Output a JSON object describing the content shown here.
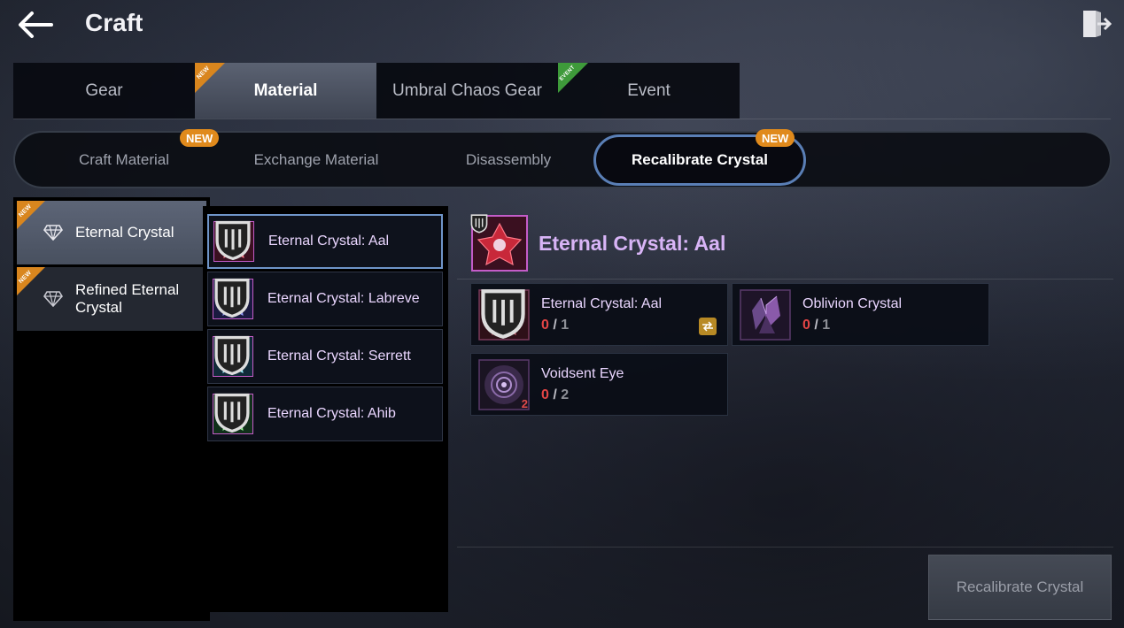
{
  "header": {
    "title": "Craft",
    "back_icon": "arrow-left-icon",
    "exit_icon": "exit-door-icon"
  },
  "main_tabs": [
    {
      "label": "Gear",
      "active": false
    },
    {
      "label": "Material",
      "active": true,
      "tag": "NEW"
    },
    {
      "label": "Umbral Chaos Gear",
      "active": false
    },
    {
      "label": "Event",
      "active": false,
      "tag": "EVENT"
    }
  ],
  "sub_tabs": [
    {
      "label": "Craft Material",
      "badge": "NEW"
    },
    {
      "label": "Exchange Material"
    },
    {
      "label": "Disassembly"
    },
    {
      "label": "Recalibrate Crystal",
      "badge": "NEW",
      "active": true
    }
  ],
  "categories": [
    {
      "label": "Eternal Crystal",
      "tag": "NEW",
      "active": true
    },
    {
      "label": "Refined Eternal Crystal",
      "tag": "NEW"
    }
  ],
  "crystals": [
    {
      "name": "Eternal Crystal: Aal",
      "color": "#c8283a",
      "active": true
    },
    {
      "name": "Eternal Crystal: Labreve",
      "color": "#4a4ee0"
    },
    {
      "name": "Eternal Crystal: Serrett",
      "color": "#2ab8d0"
    },
    {
      "name": "Eternal Crystal: Ahib",
      "color": "#2aa83a"
    }
  ],
  "detail": {
    "title": "Eternal Crystal: Aal",
    "materials": [
      {
        "name": "Eternal Crystal: Aal",
        "have": "0",
        "sep": "/",
        "need": "1",
        "icon": "red-crystal-icon"
      },
      {
        "name": "Oblivion Crystal",
        "have": "0",
        "sep": "/",
        "need": "1",
        "icon": "purple-shard-icon"
      },
      {
        "name": "Voidsent Eye",
        "have": "0",
        "sep": "/",
        "need": "2",
        "qty": "2",
        "icon": "void-eye-icon"
      }
    ],
    "action_label": "Recalibrate Crystal"
  },
  "colors": {
    "accent_blue": "#5a7fb6",
    "new_orange": "#e08a1c",
    "event_green": "#3e9a3a",
    "title_purple": "#d8b4f6",
    "missing_red": "#e44545"
  }
}
